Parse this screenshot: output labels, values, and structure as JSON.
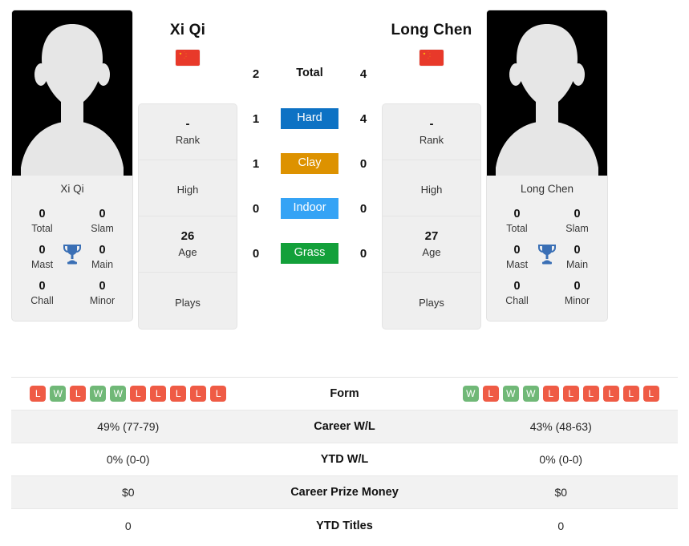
{
  "players": {
    "left": {
      "name": "Xi Qi",
      "photo_caption": "Xi Qi",
      "flag": "cn-flag-icon",
      "rank": "-",
      "rank_label": "Rank",
      "high": "",
      "high_label": "High",
      "age": "26",
      "age_label": "Age",
      "plays": "",
      "plays_label": "Plays",
      "titles": {
        "total": "0",
        "total_label": "Total",
        "slam": "0",
        "slam_label": "Slam",
        "mast": "0",
        "mast_label": "Mast",
        "main": "0",
        "main_label": "Main",
        "chall": "0",
        "chall_label": "Chall",
        "minor": "0",
        "minor_label": "Minor"
      },
      "form": [
        "L",
        "W",
        "L",
        "W",
        "W",
        "L",
        "L",
        "L",
        "L",
        "L"
      ],
      "career_wl": "49% (77-79)",
      "ytd_wl": "0% (0-0)",
      "career_prize_money": "$0",
      "ytd_titles": "0"
    },
    "right": {
      "name": "Long Chen",
      "photo_caption": "Long Chen",
      "flag": "cn-flag-icon",
      "rank": "-",
      "rank_label": "Rank",
      "high": "",
      "high_label": "High",
      "age": "27",
      "age_label": "Age",
      "plays": "",
      "plays_label": "Plays",
      "titles": {
        "total": "0",
        "total_label": "Total",
        "slam": "0",
        "slam_label": "Slam",
        "mast": "0",
        "mast_label": "Mast",
        "main": "0",
        "main_label": "Main",
        "chall": "0",
        "chall_label": "Chall",
        "minor": "0",
        "minor_label": "Minor"
      },
      "form": [
        "W",
        "L",
        "W",
        "W",
        "L",
        "L",
        "L",
        "L",
        "L",
        "L"
      ],
      "career_wl": "43% (48-63)",
      "ytd_wl": "0% (0-0)",
      "career_prize_money": "$0",
      "ytd_titles": "0"
    }
  },
  "surfaces": [
    {
      "label": "Total",
      "left": "2",
      "right": "4",
      "color": "none",
      "plain": true
    },
    {
      "label": "Hard",
      "left": "1",
      "right": "4",
      "color": "#0d72c4",
      "plain": false
    },
    {
      "label": "Clay",
      "left": "1",
      "right": "0",
      "color": "#dd9200",
      "plain": false
    },
    {
      "label": "Indoor",
      "left": "0",
      "right": "0",
      "color": "#35a3f5",
      "plain": false
    },
    {
      "label": "Grass",
      "left": "0",
      "right": "0",
      "color": "#13a03a",
      "plain": false
    }
  ],
  "table_rows": [
    {
      "label": "Form",
      "key": "form",
      "type": "form"
    },
    {
      "label": "Career W/L",
      "key": "career_wl",
      "type": "text"
    },
    {
      "label": "YTD W/L",
      "key": "ytd_wl",
      "type": "text"
    },
    {
      "label": "Career Prize Money",
      "key": "career_prize_money",
      "type": "text"
    },
    {
      "label": "YTD Titles",
      "key": "ytd_titles",
      "type": "text"
    }
  ],
  "colors": {
    "hard": "#0d72c4",
    "clay": "#dd9200",
    "indoor": "#35a3f5",
    "grass": "#13a03a",
    "win": "#70b877",
    "loss": "#ef5b45",
    "card_bg": "#efefef",
    "row_shade": "#f2f2f2"
  }
}
